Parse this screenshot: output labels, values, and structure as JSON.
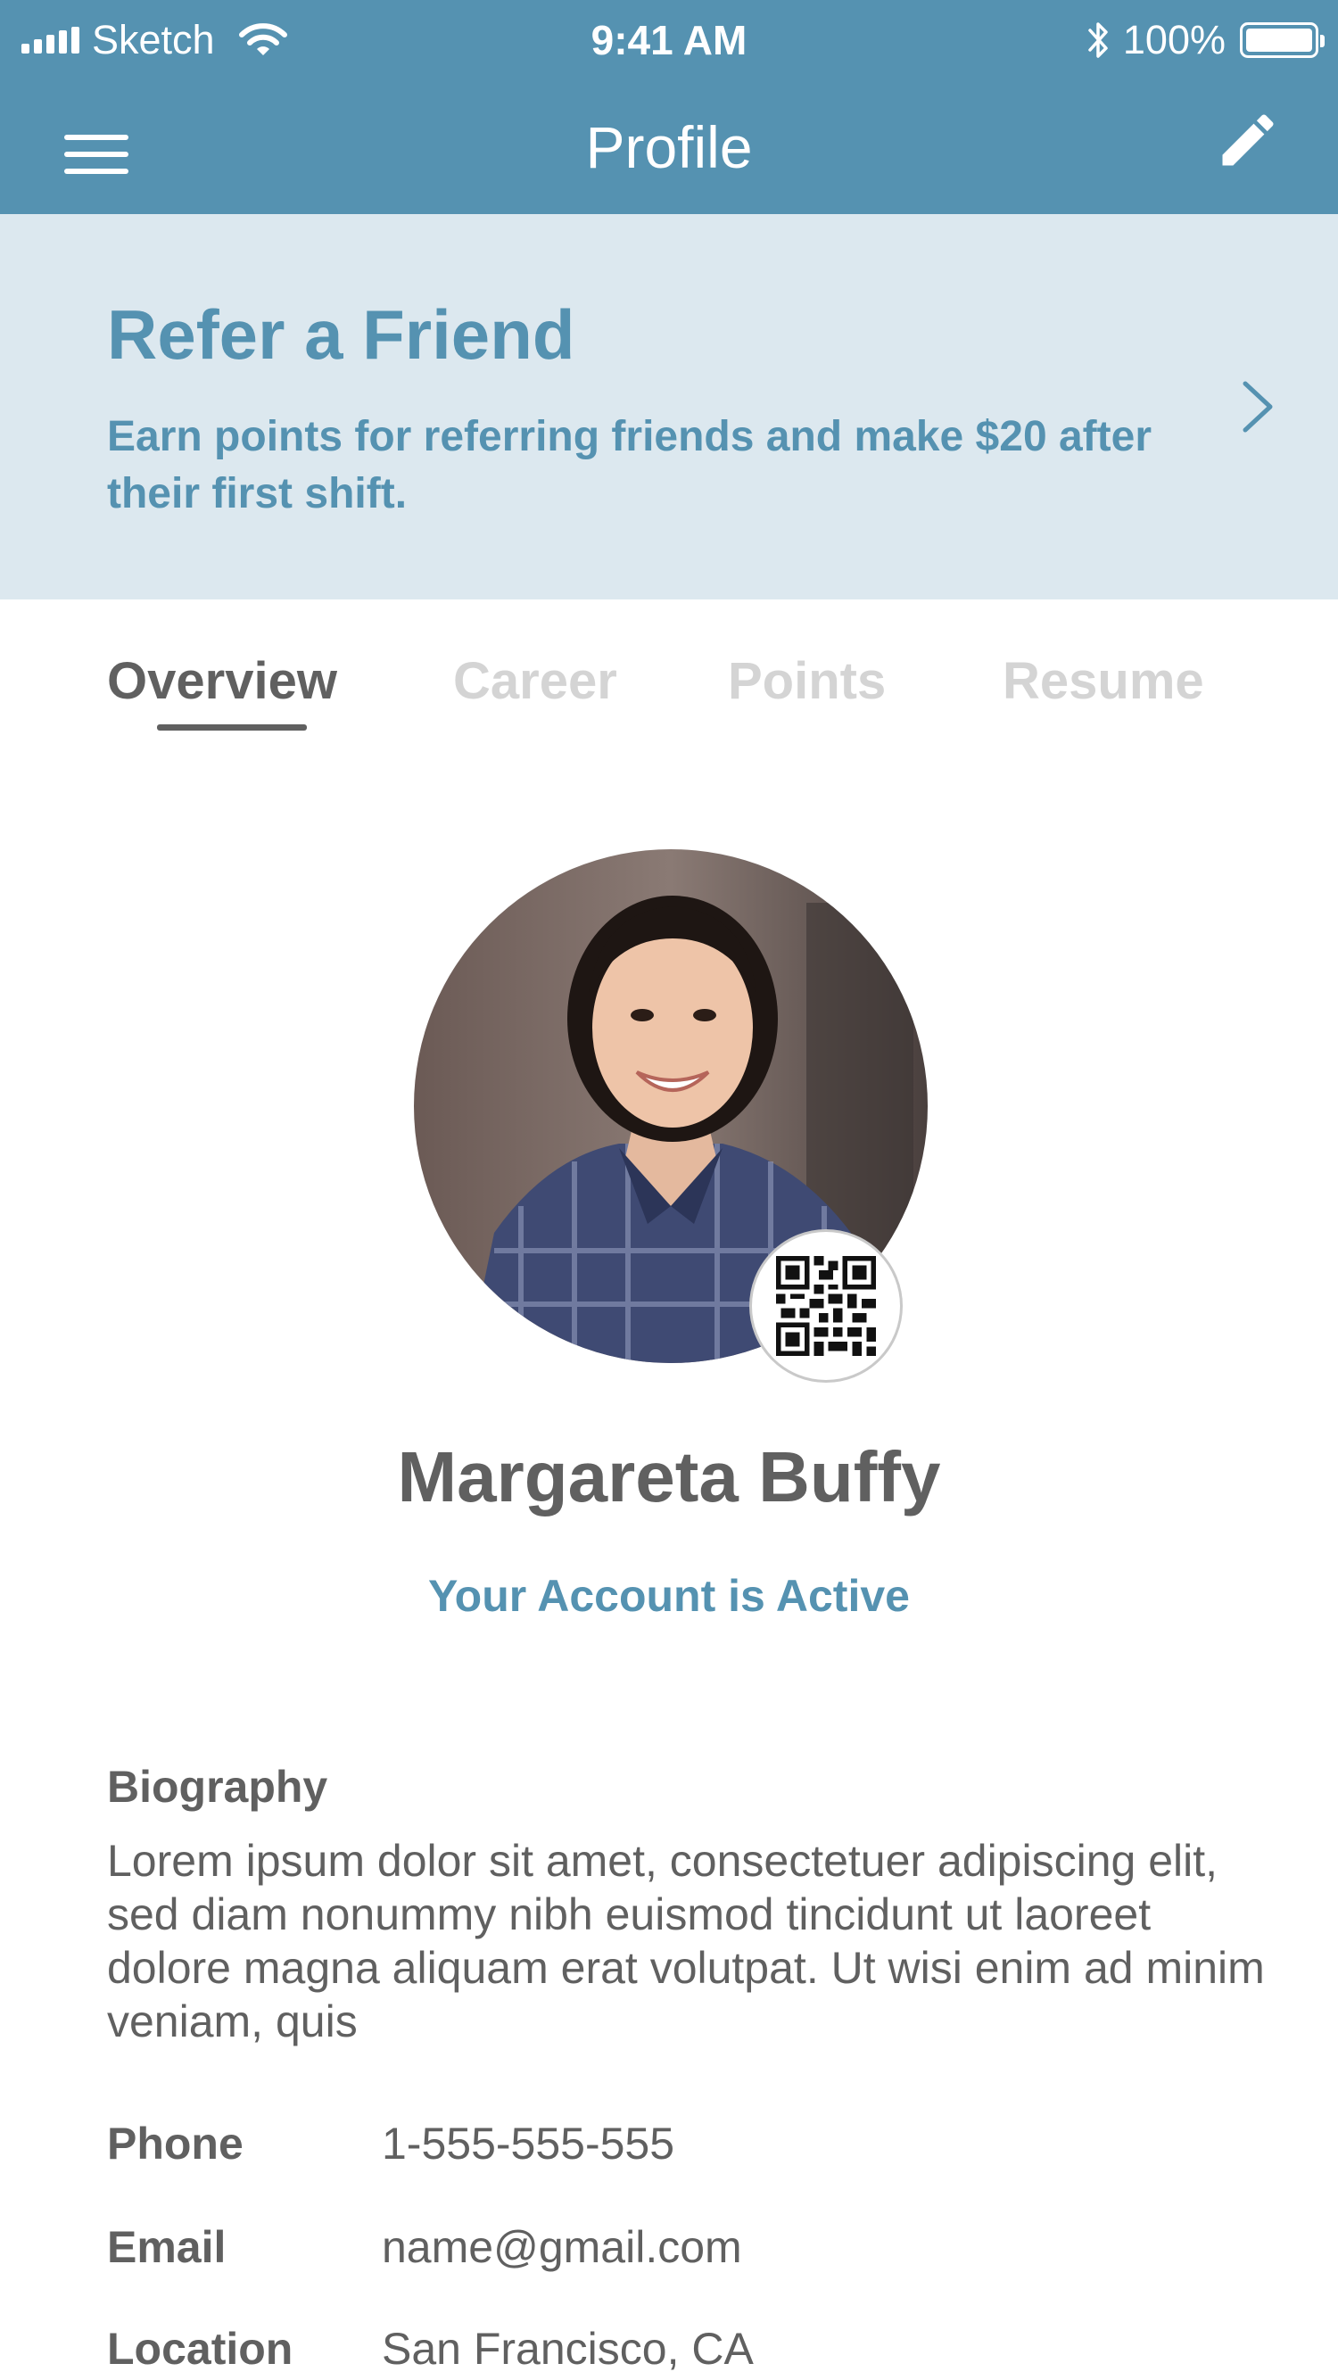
{
  "status_bar": {
    "carrier": "Sketch",
    "time": "9:41 AM",
    "battery": "100%"
  },
  "nav": {
    "title": "Profile",
    "menu_icon": "hamburger-menu-icon",
    "edit_icon": "pencil-icon"
  },
  "refer": {
    "title": "Refer a Friend",
    "description": "Earn points for referring friends and make $20 after their first shift.",
    "chevron_icon": "chevron-right-icon"
  },
  "tabs": [
    {
      "label": "Overview",
      "active": true
    },
    {
      "label": "Career",
      "active": false
    },
    {
      "label": "Points",
      "active": false
    },
    {
      "label": "Resume",
      "active": false
    }
  ],
  "profile": {
    "name": "Margareta Buffy",
    "status": "Your Account is Active",
    "qr_icon": "qr-code-icon"
  },
  "details": {
    "biography_label": "Biography",
    "biography": "Lorem ipsum dolor sit amet, consectetuer adipiscing elit, sed diam nonummy nibh euismod tincidunt ut laoreet dolore magna aliquam erat volutpat. Ut wisi enim ad minim veniam, quis",
    "rows": [
      {
        "label": "Phone",
        "value": "1-555-555-555"
      },
      {
        "label": "Email",
        "value": "name@gmail.com"
      },
      {
        "label": "Location",
        "value": "San Francisco, CA"
      }
    ]
  },
  "colors": {
    "header": "#5592b1",
    "banner": "#dce8ef",
    "accent": "#5592b1",
    "text": "#606060",
    "tab_inactive": "#d4d4d4"
  }
}
